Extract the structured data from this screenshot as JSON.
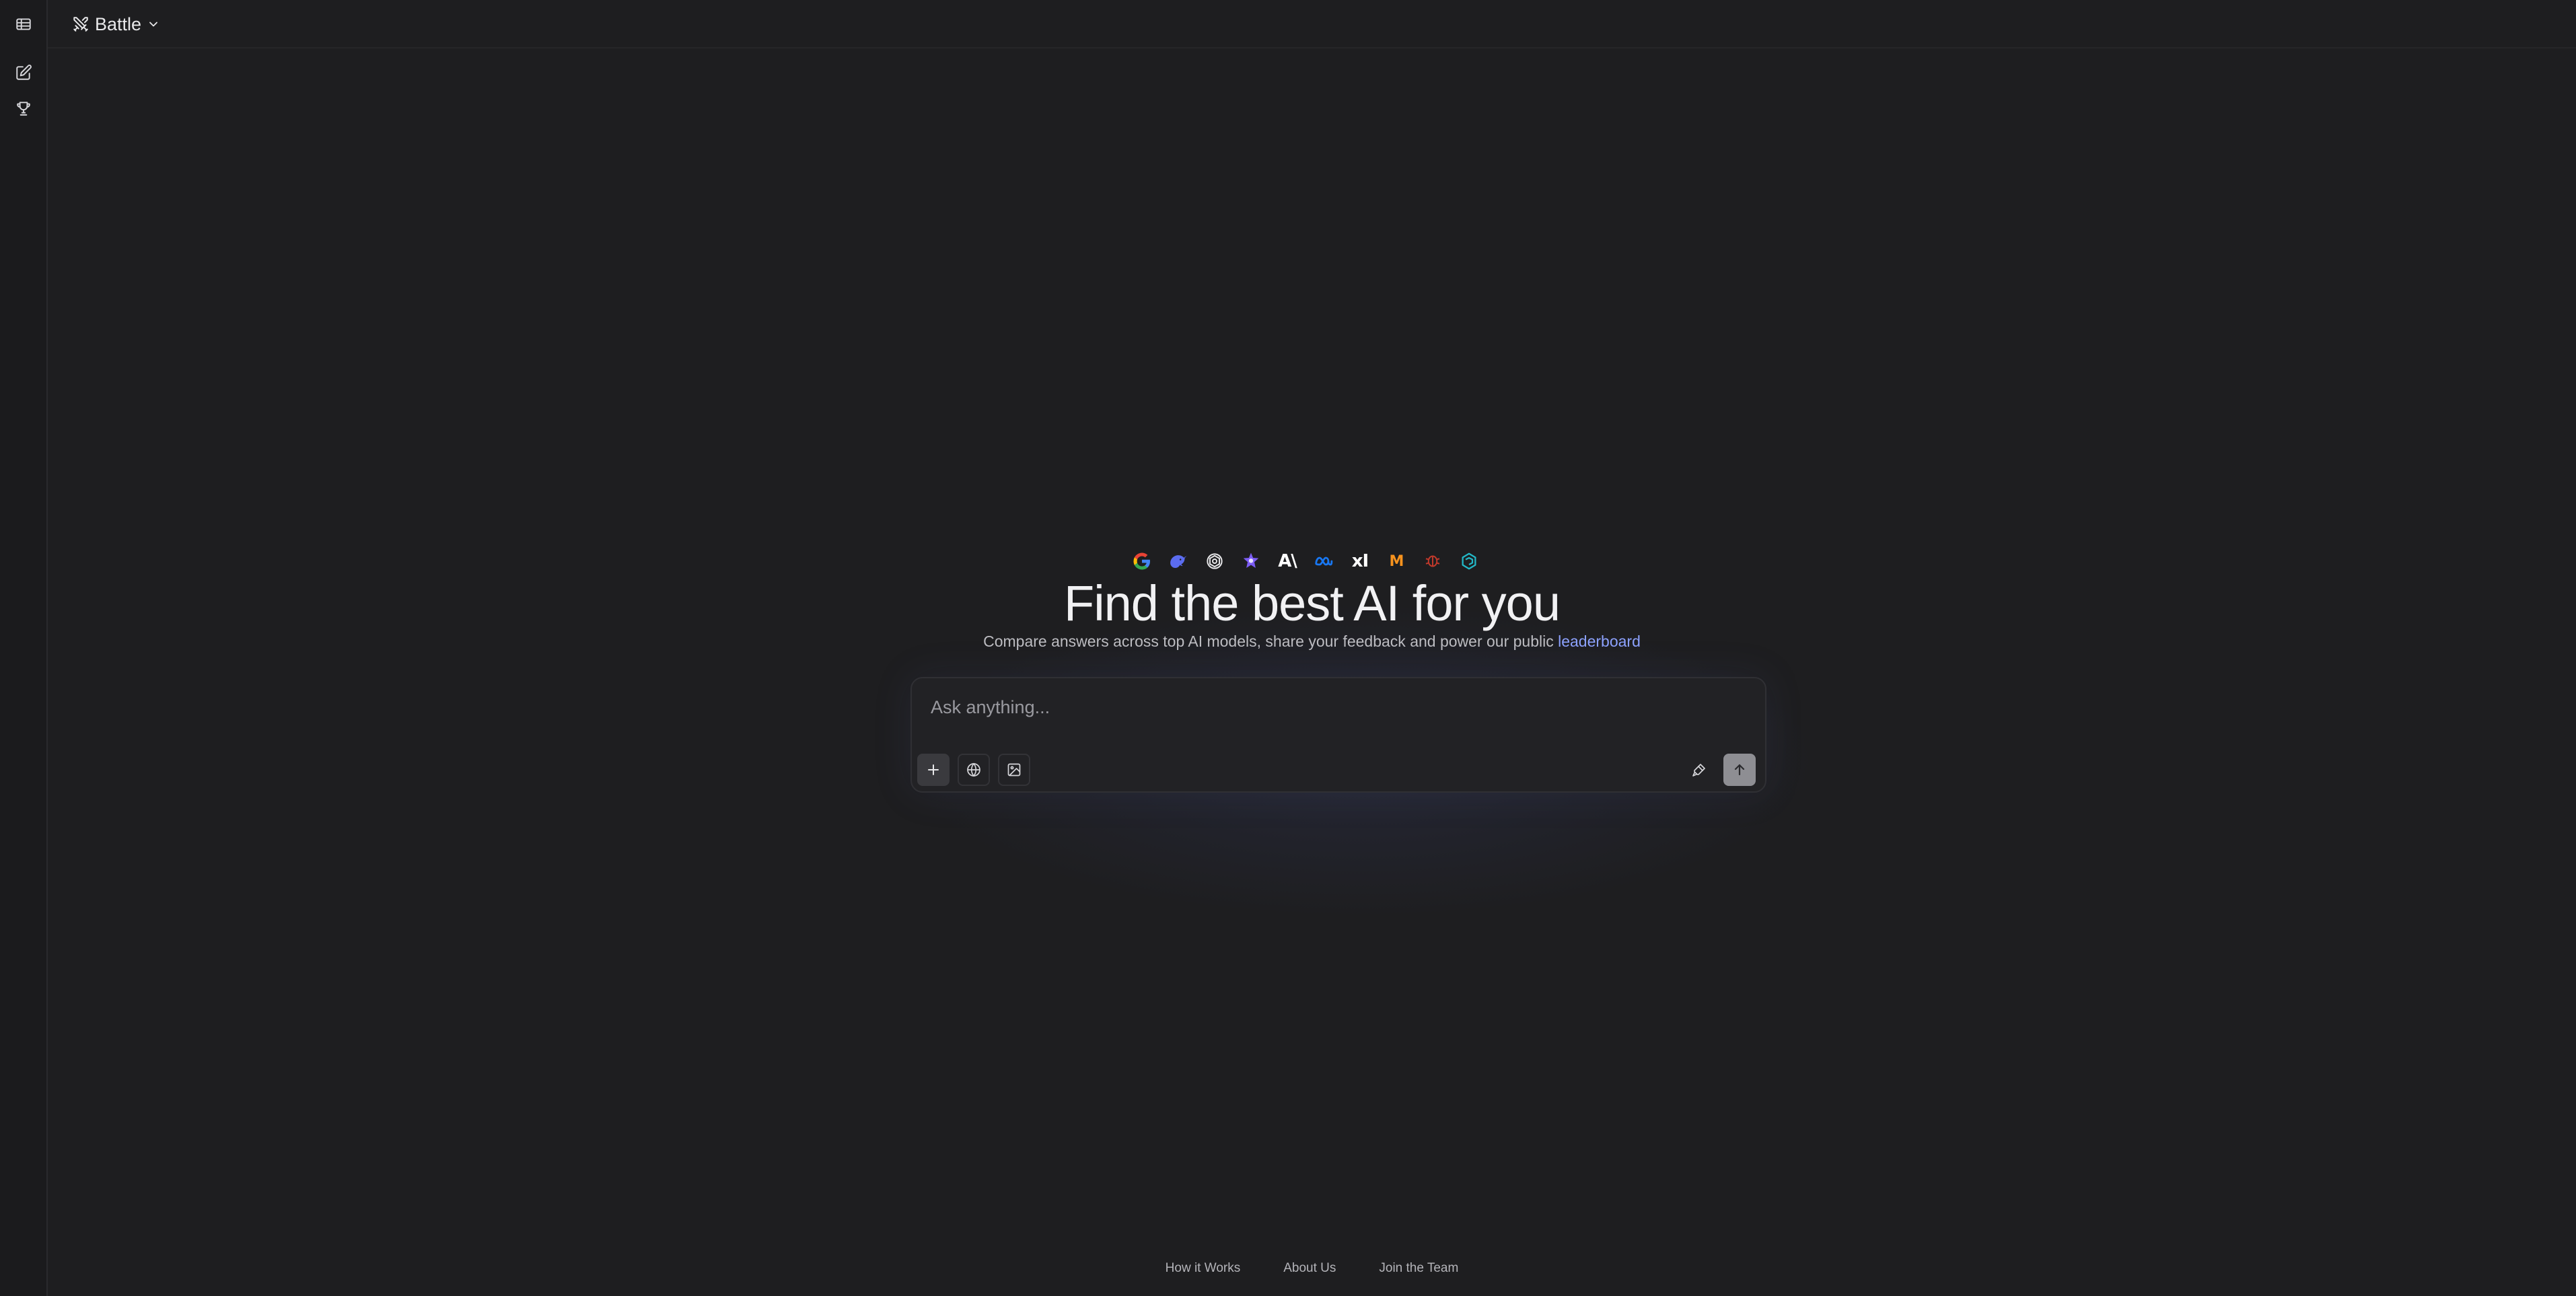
{
  "sidebar": {
    "items": [
      {
        "icon": "panel-icon"
      },
      {
        "icon": "new-chat-icon"
      },
      {
        "icon": "trophy-icon"
      }
    ]
  },
  "header": {
    "mode_label": "Battle",
    "mode_icon": "swords-icon"
  },
  "hero": {
    "provider_logos": [
      "google-icon",
      "deepseek-icon",
      "openai-icon",
      "starflower-icon",
      "anthropic-icon",
      "meta-icon",
      "xai-icon",
      "mistral-icon",
      "redbug-icon",
      "qwen-icon"
    ],
    "anthropic_text": "A\\",
    "xai_text": "xI",
    "mistral_text": "M",
    "title": "Find the best AI for you",
    "subtitle_text": "Compare answers across top AI models, share your feedback and power our public ",
    "subtitle_link": "leaderboard"
  },
  "composer": {
    "placeholder": "Ask anything...",
    "value": ""
  },
  "footer": {
    "links": [
      "How it Works",
      "About Us",
      "Join the Team"
    ]
  },
  "colors": {
    "background": "#1e1e20",
    "sidebar": "#1b1b1d",
    "link": "#8da2ff",
    "send_button": "#8e8e93"
  }
}
